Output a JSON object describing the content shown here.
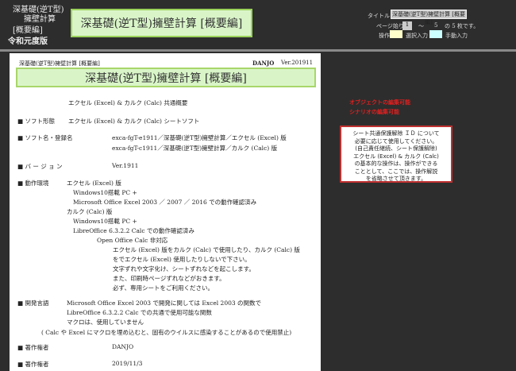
{
  "header": {
    "side_title_1": "深基礎(逆T型)",
    "side_title_2": "擁壁計算",
    "side_edition": "[概要編]",
    "side_version": "令和元度版",
    "main_title": "深基礎(逆T型)擁壁計算 [概要編]"
  },
  "controls": {
    "title_label": "タイトル",
    "title_value": "深基礎(逆T型)擁壁計算 [概要編]",
    "page_start_label": "ページ始り",
    "page_start_value": "1",
    "tilde": "～",
    "page_end": "5",
    "page_suffix": "の 5 枚です。",
    "op_label": "操作",
    "select_input_label": "選択入力",
    "manual_input_label": "手動入力",
    "select_color": "#ffffcc",
    "manual_color": "#ccffff"
  },
  "page": {
    "header_left": "深基礎(逆T型)擁壁計算 [概要編]",
    "author": "DANJO",
    "version": "Ver.201911",
    "title": "深基礎(逆T型)擁壁計算 [概要編]",
    "lines": [
      "エクセル (Excel) & カルク (Calc) 共通概要",
      "■ ソフト形態",
      "エクセル (Excel) & カルク (Calc) シートソフト",
      "■ ソフト名・登録名",
      "exca-fgT-e1911／深基礎(逆T型)擁壁計算／エクセル (Excel) 版",
      "exca-fgT-c1911／深基礎(逆T型)擁壁計算／カルク (Calc) 版",
      "■ バ ー ジ ョ ン",
      "Ver.1911",
      "■ 動作環境",
      "エクセル (Excel) 版",
      "Windows10搭載 PC +",
      "Microsoft Office Excel 2003 ／ 2007 ／ 2016 での動作確認済み",
      "カルク (Calc) 版",
      "Windows10搭載 PC +",
      "LibreOffice 6.3.2.2 Calc での動作確認済み",
      "Open Office Calc 非対応",
      "エクセル (Excel) 版をカルク (Calc) で使用したり、カルク (Calc) 版",
      "をでエクセル (Excel) 使用したりしないで下さい。",
      "文字ずれや文字化け、シートずれなどを起こします。",
      "また、印刷時ページずれなどがおきます。",
      "必ず、専用シートをご利用ください。",
      "■ 開発言語",
      "Microsoft Office Excel 2003 で開発に関しては Excel 2003 の関数で",
      "LibreOffice 6.3.2.2 Calc での共通で使用可能な関数",
      "マクロは、使用していません",
      "( Calc や Excel にマクロを埋め込むと、固有のウイルスに感染することがあるので使用禁止)",
      "■ 著作権者",
      "DANJO",
      "■ 著作権者",
      "2019/11/3"
    ]
  },
  "notices": {
    "red_1": "オブジェクトの編集可能",
    "red_2": "シナリオの編集可能",
    "box": [
      "シート共通保護解除 ＩＤ について",
      "必要に応じて使用してください。",
      "(自己責任継続、シート保護解除)",
      "エクセル (Excel) & カルク (Calc)",
      "の基本的な操作は、操作ができる",
      "こととして、ここでは、操作解説",
      "を省略させて頂きます。"
    ]
  }
}
